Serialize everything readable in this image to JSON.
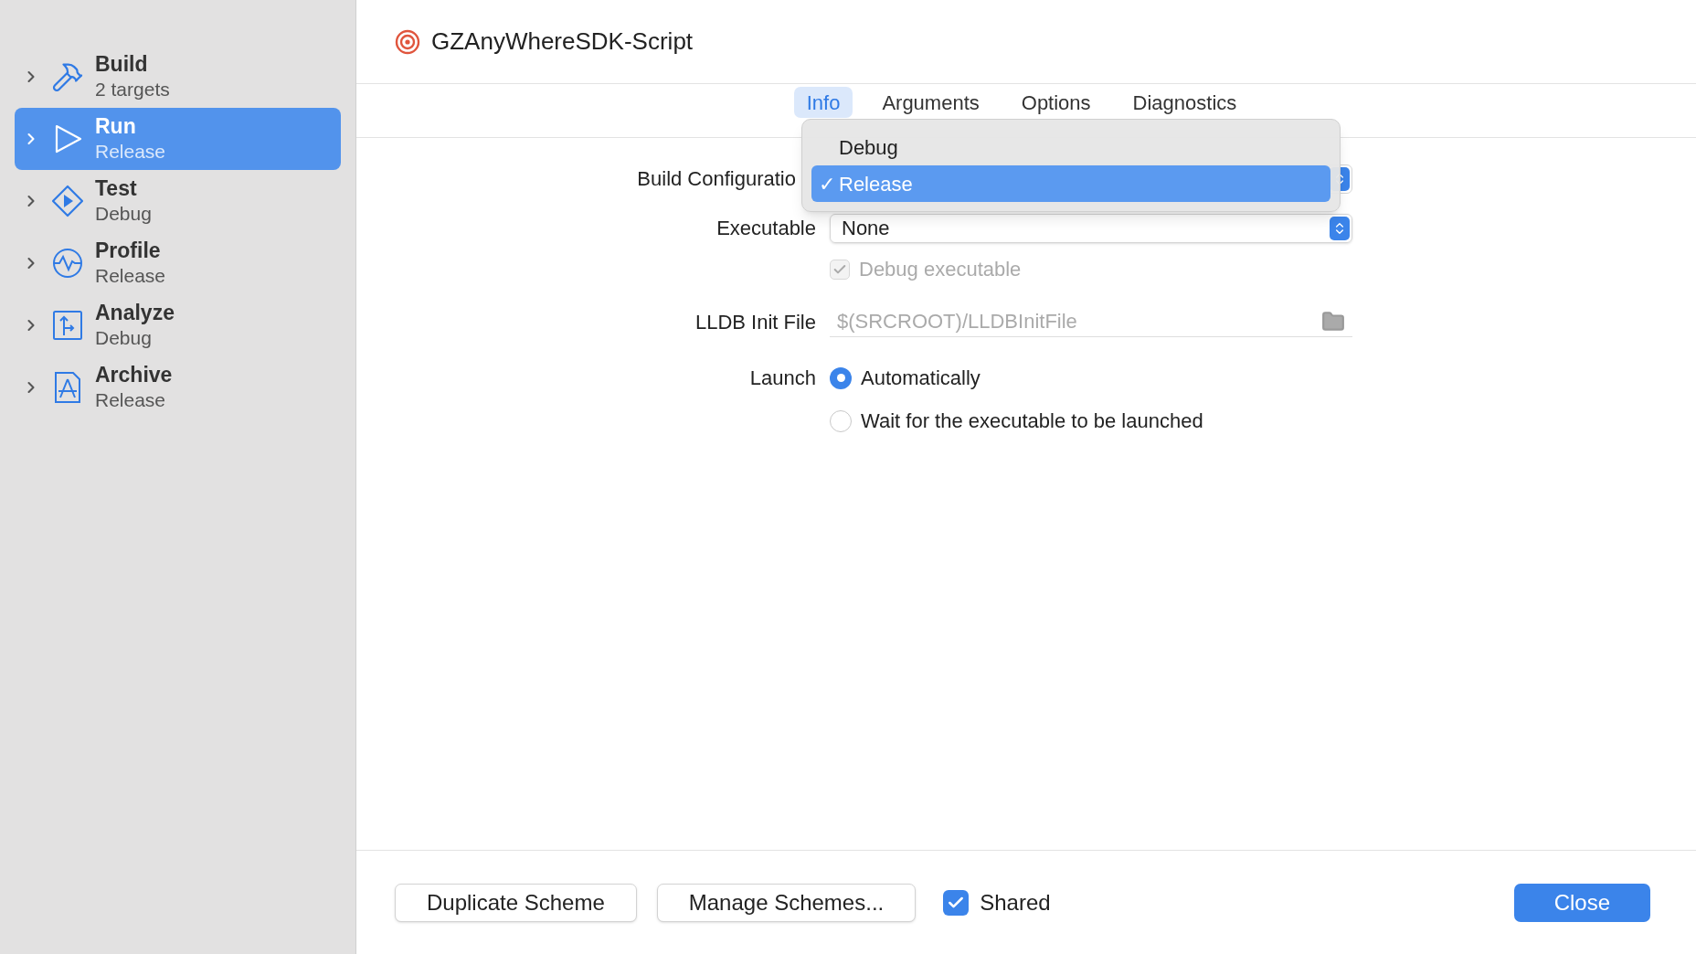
{
  "sidebar": {
    "items": [
      {
        "title": "Build",
        "subtitle": "2 targets",
        "selected": false
      },
      {
        "title": "Run",
        "subtitle": "Release",
        "selected": true
      },
      {
        "title": "Test",
        "subtitle": "Debug",
        "selected": false
      },
      {
        "title": "Profile",
        "subtitle": "Release",
        "selected": false
      },
      {
        "title": "Analyze",
        "subtitle": "Debug",
        "selected": false
      },
      {
        "title": "Archive",
        "subtitle": "Release",
        "selected": false
      }
    ]
  },
  "header": {
    "title": "GZAnyWhereSDK-Script"
  },
  "tabs": [
    {
      "label": "Info",
      "selected": true
    },
    {
      "label": "Arguments",
      "selected": false
    },
    {
      "label": "Options",
      "selected": false
    },
    {
      "label": "Diagnostics",
      "selected": false
    }
  ],
  "form": {
    "build_configuration": {
      "label": "Build Configuratio"
    },
    "executable": {
      "label": "Executable",
      "value": "None"
    },
    "debug_executable": {
      "label": "Debug executable",
      "checked": true,
      "disabled": true
    },
    "lldb_init_file": {
      "label": "LLDB Init File",
      "placeholder": "$(SRCROOT)/LLDBInitFile"
    },
    "launch": {
      "label": "Launch",
      "options": [
        {
          "label": "Automatically",
          "selected": true
        },
        {
          "label": "Wait for the executable to be launched",
          "selected": false
        }
      ]
    }
  },
  "menu": {
    "items": [
      {
        "label": "Debug",
        "selected": false
      },
      {
        "label": "Release",
        "selected": true
      }
    ],
    "check": "✓"
  },
  "footer": {
    "buttons": [
      "Duplicate Scheme",
      "Manage Schemes..."
    ],
    "shared": {
      "label": "Shared",
      "checked": true
    },
    "close": "Close"
  }
}
